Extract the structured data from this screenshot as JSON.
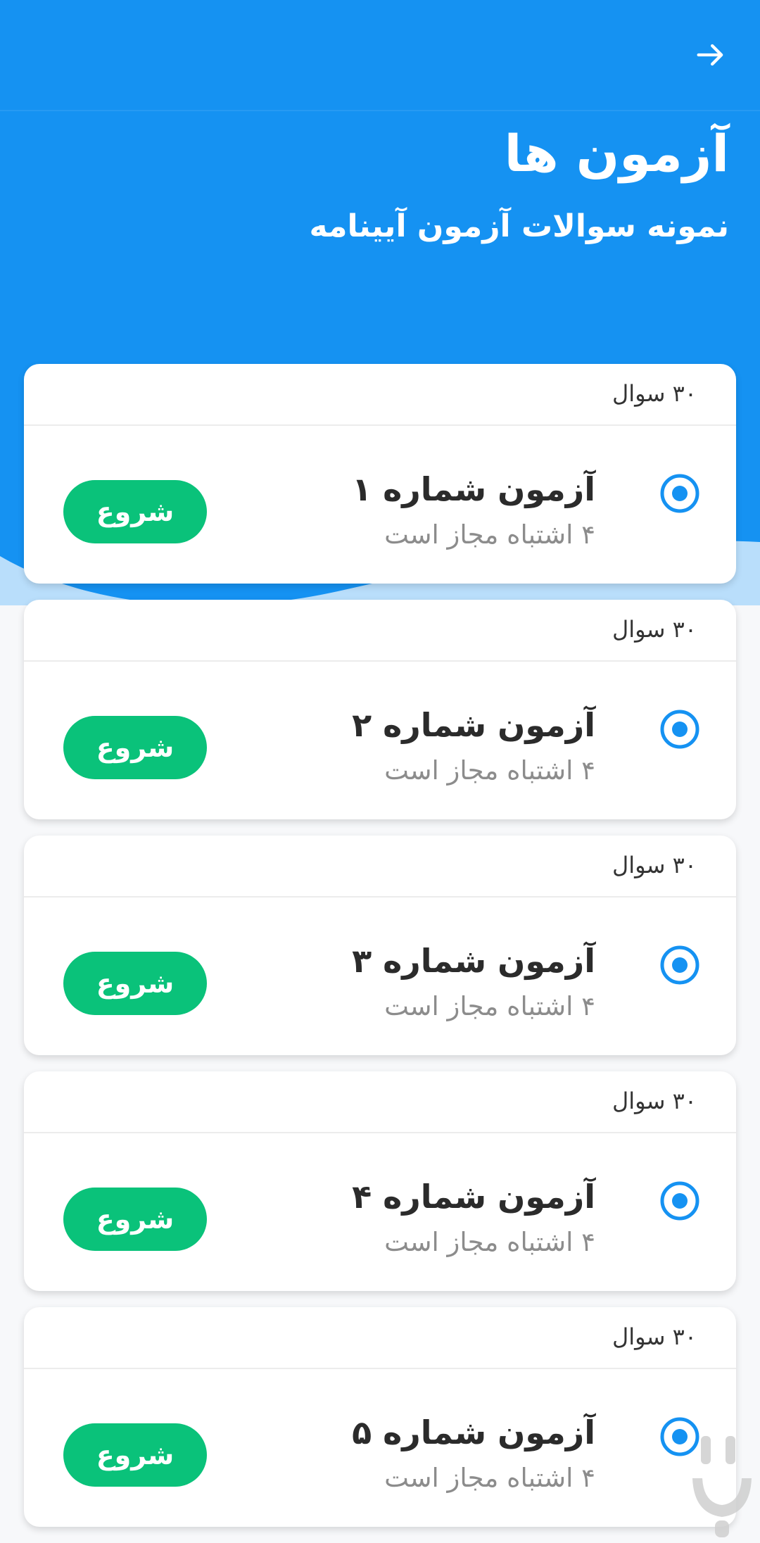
{
  "header": {
    "title": "آزمون ها",
    "subtitle": "نمونه سوالات آزمون آیینامه",
    "back_icon": "arrow-right-icon"
  },
  "colors": {
    "primary": "#1592f2",
    "start_button": "#0ac27a",
    "radio": "#1592f2"
  },
  "exams": [
    {
      "questions": "۳۰ سوال",
      "title": "آزمون شماره ۱",
      "mistakes": "۴ اشتباه مجاز است",
      "start_label": "شروع"
    },
    {
      "questions": "۳۰ سوال",
      "title": "آزمون شماره ۲",
      "mistakes": "۴ اشتباه مجاز است",
      "start_label": "شروع"
    },
    {
      "questions": "۳۰ سوال",
      "title": "آزمون شماره ۳",
      "mistakes": "۴ اشتباه مجاز است",
      "start_label": "شروع"
    },
    {
      "questions": "۳۰ سوال",
      "title": "آزمون شماره ۴",
      "mistakes": "۴ اشتباه مجاز است",
      "start_label": "شروع"
    },
    {
      "questions": "۳۰ سوال",
      "title": "آزمون شماره ۵",
      "mistakes": "۴ اشتباه مجاز است",
      "start_label": "شروع"
    }
  ]
}
